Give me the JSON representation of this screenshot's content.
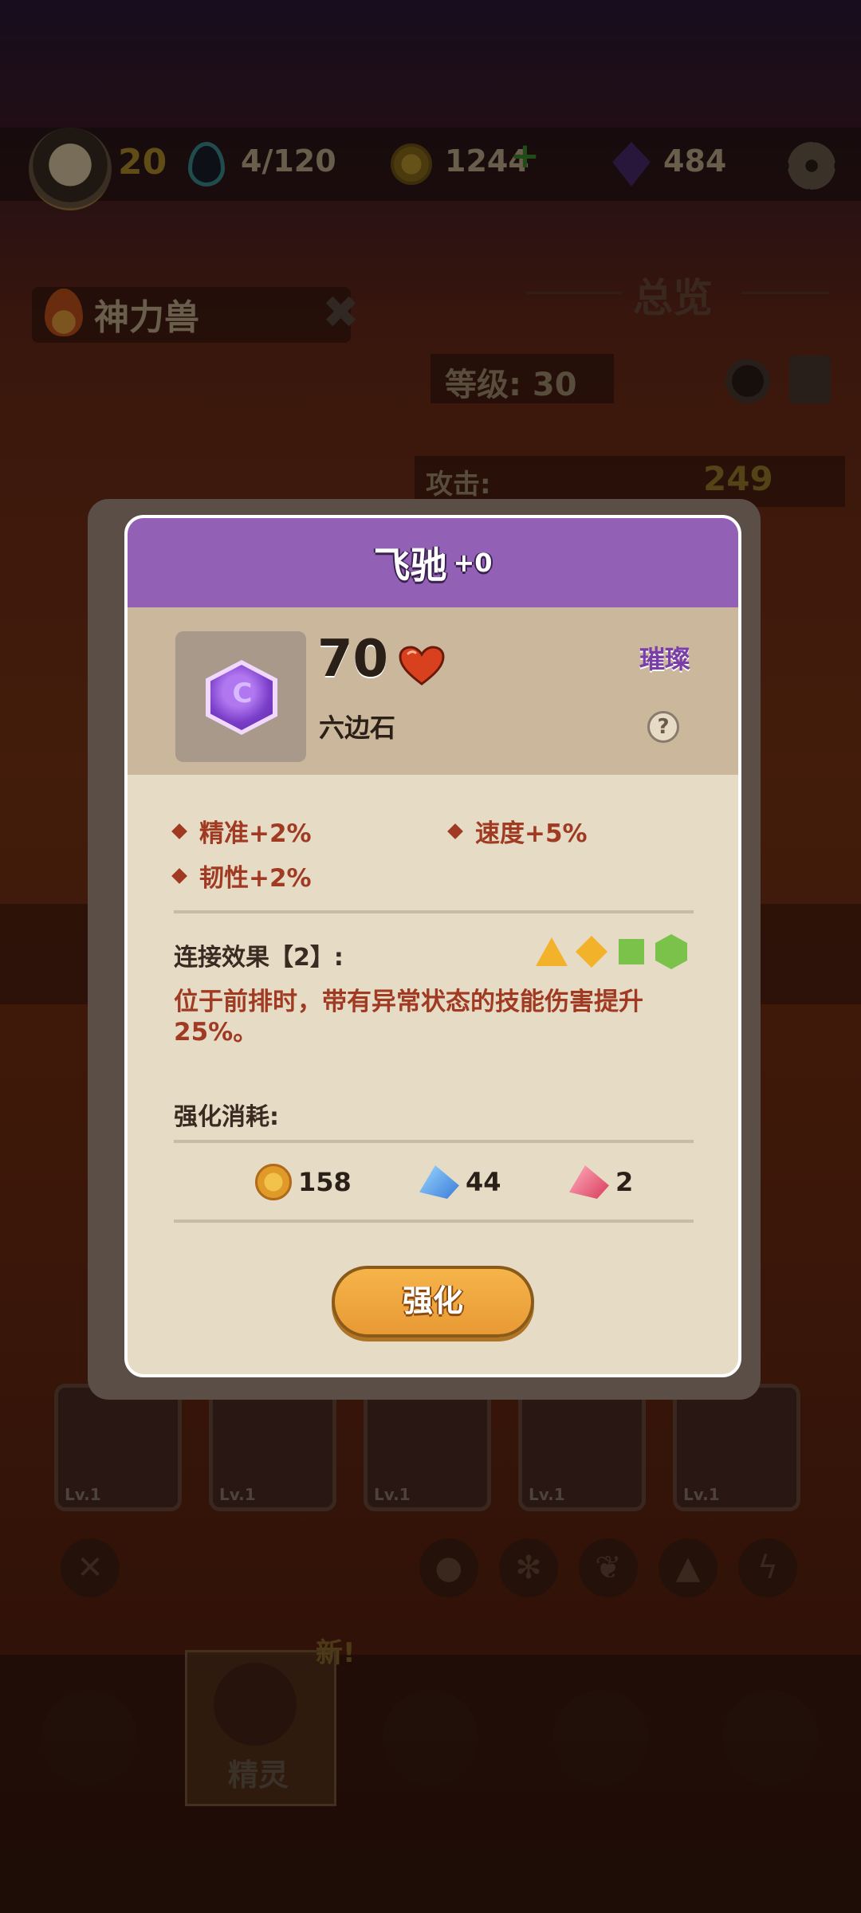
{
  "topbar": {
    "player_level": "20",
    "energy": "4/120",
    "coins": "1244",
    "gems": "484"
  },
  "monster": {
    "name": "神力兽"
  },
  "overview": {
    "title": "总览",
    "level_label": "等级: 30",
    "attack_label": "攻击:",
    "attack_value": "249"
  },
  "cards": [
    {
      "lv": "Lv.1"
    },
    {
      "lv": "Lv.1"
    },
    {
      "lv": "Lv.1"
    },
    {
      "lv": "Lv.1"
    },
    {
      "lv": "Lv.1"
    }
  ],
  "nav": {
    "active_label": "精灵",
    "new_badge": "新!"
  },
  "modal": {
    "title": "飞驰",
    "enhance_level": "+0",
    "gem_value": "70",
    "gem_type": "六边石",
    "gem_letter": "C",
    "rarity": "璀璨",
    "help": "?",
    "stats": [
      "精准+2%",
      "速度+5%",
      "韧性+2%"
    ],
    "link_label": "连接效果【2】:",
    "link_text": "位于前排时，带有异常状态的技能伤害提升25%。",
    "cost_label": "强化消耗:",
    "costs": {
      "coin": "158",
      "blue": "44",
      "red": "2"
    },
    "upgrade_button": "强化"
  },
  "colors": {
    "header_purple": "#9260b4",
    "stat_red": "#a03a22",
    "button_orange": "#f2a83e",
    "rarity_purple": "#7a3ea8"
  }
}
